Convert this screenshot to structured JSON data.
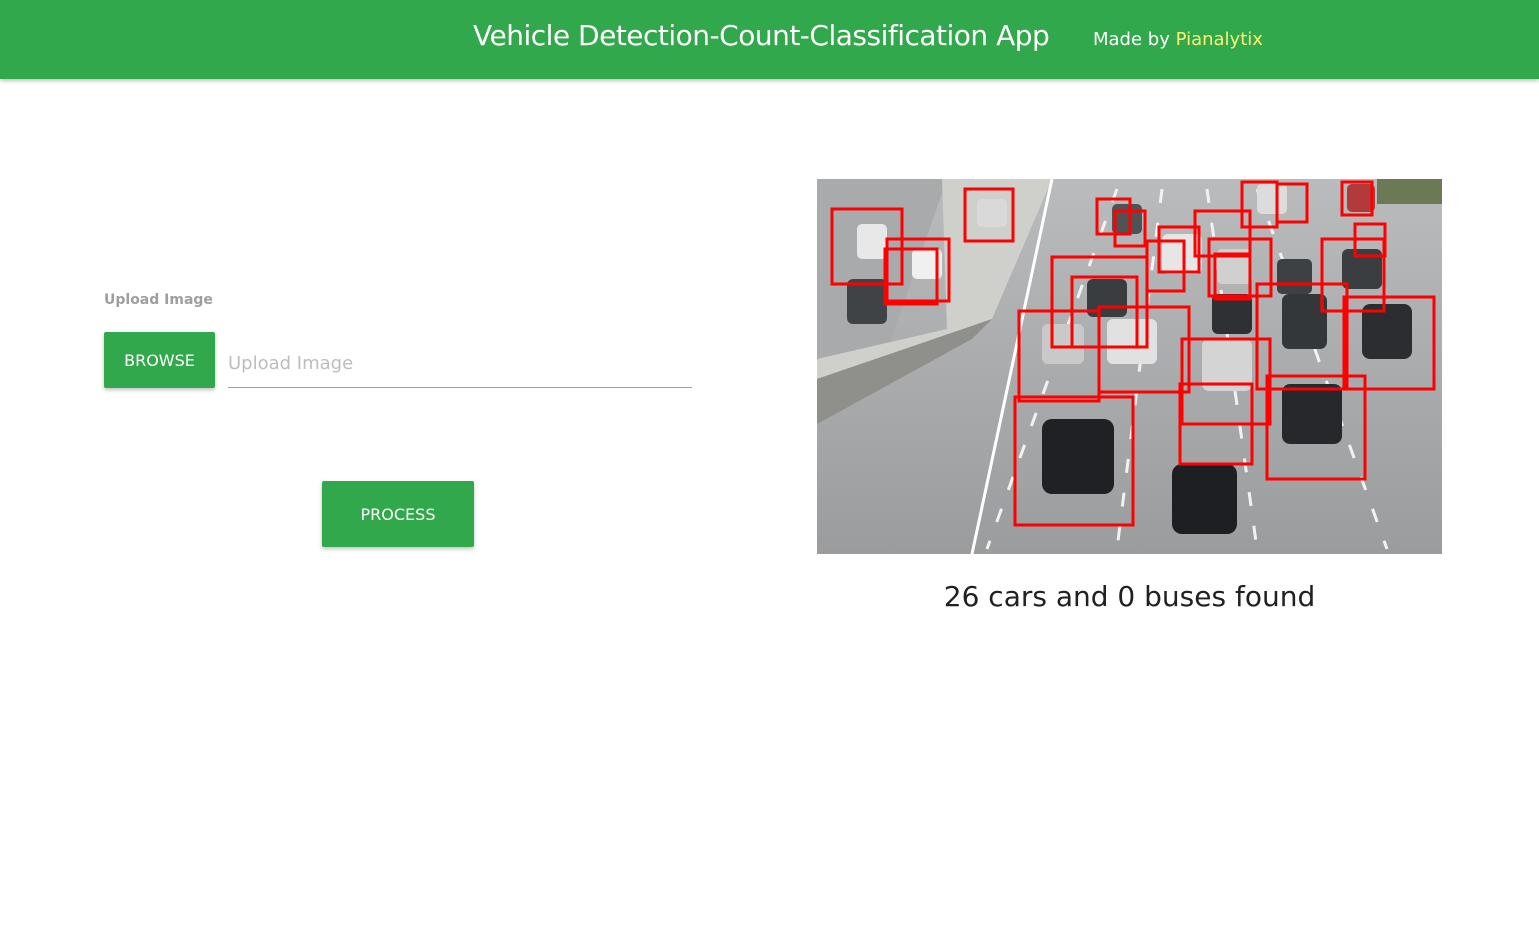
{
  "header": {
    "title": "Vehicle Detection-Count-Classification App",
    "made_by_prefix": "Made by",
    "made_by_brand": "Pianalytix",
    "brand_color": "#fff176",
    "bar_color": "#31a84b"
  },
  "upload": {
    "label": "Upload Image",
    "browse_label": "BROWSE",
    "path_placeholder": "Upload Image",
    "path_value": ""
  },
  "actions": {
    "process_label": "PROCESS"
  },
  "result": {
    "summary": "26 cars and 0 buses found",
    "cars_count": 26,
    "buses_count": 0,
    "detection_box_color": "#ff0000"
  }
}
